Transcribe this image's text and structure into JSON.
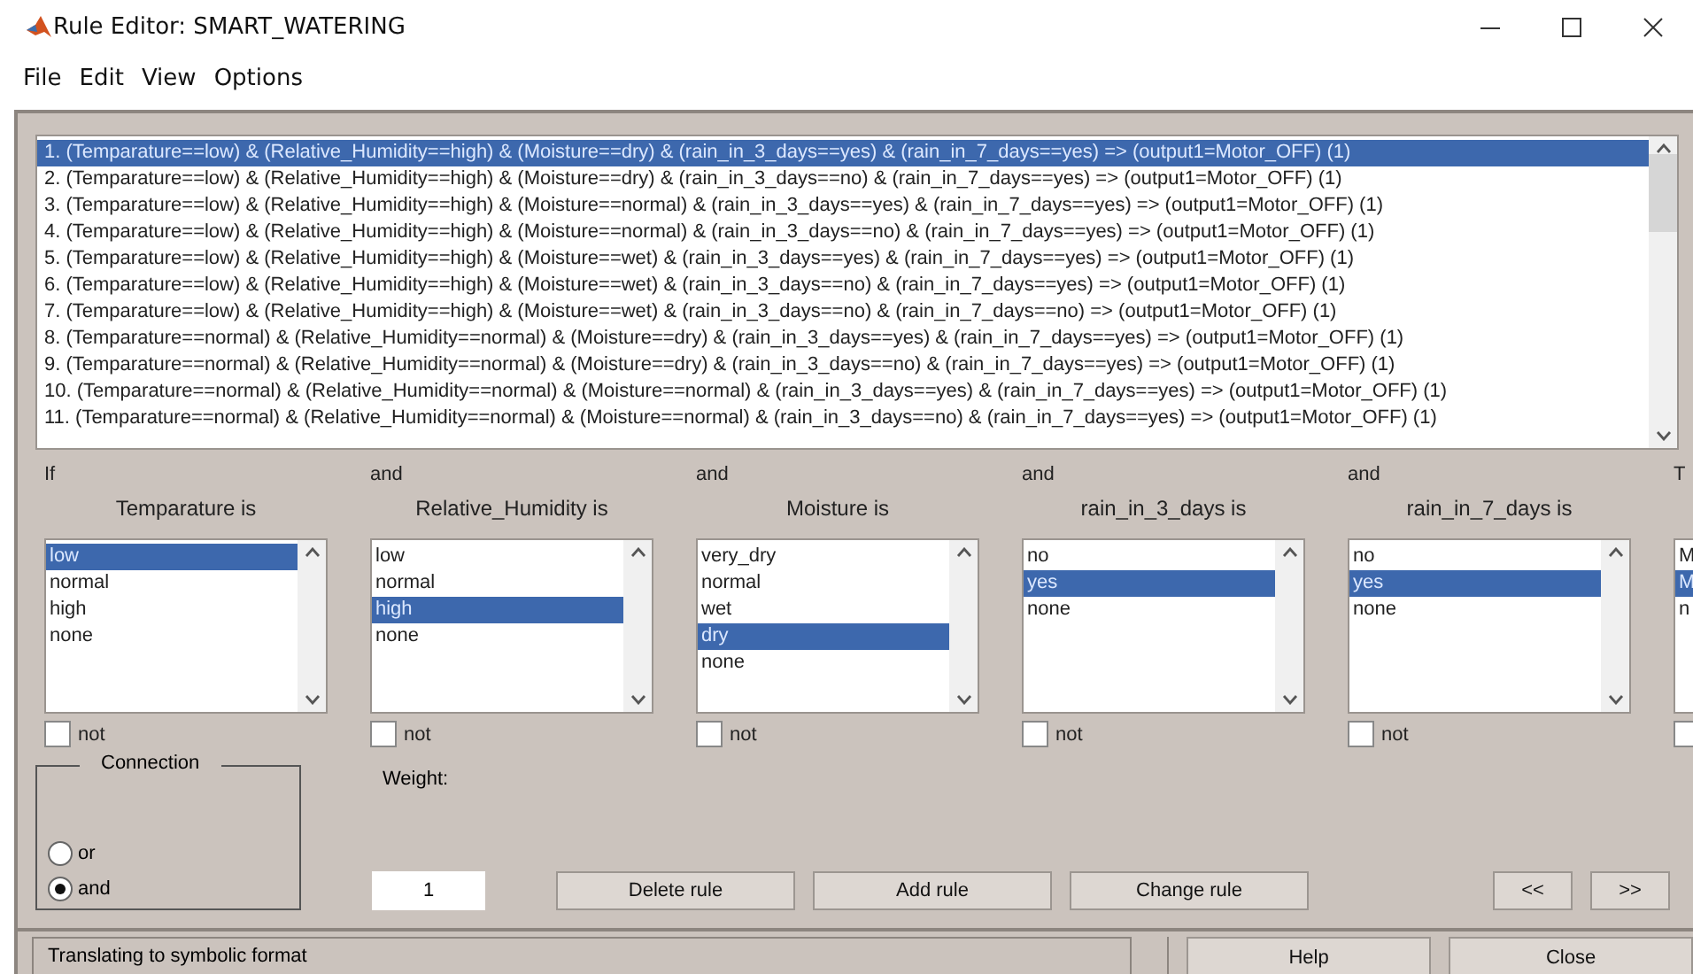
{
  "window": {
    "title": "Rule Editor: SMART_WATERING"
  },
  "menu": [
    "File",
    "Edit",
    "View",
    "Options"
  ],
  "rules": [
    {
      "text": "1. (Temparature==low) & (Relative_Humidity==high) & (Moisture==dry) & (rain_in_3_days==yes) & (rain_in_7_days==yes) => (output1=Motor_OFF) (1)",
      "selected": true
    },
    {
      "text": "2. (Temparature==low) & (Relative_Humidity==high) & (Moisture==dry) & (rain_in_3_days==no) & (rain_in_7_days==yes) => (output1=Motor_OFF) (1)",
      "selected": false
    },
    {
      "text": "3. (Temparature==low) & (Relative_Humidity==high) & (Moisture==normal) & (rain_in_3_days==yes) & (rain_in_7_days==yes) => (output1=Motor_OFF) (1)",
      "selected": false
    },
    {
      "text": "4. (Temparature==low) & (Relative_Humidity==high) & (Moisture==normal) & (rain_in_3_days==no) & (rain_in_7_days==yes) => (output1=Motor_OFF) (1)",
      "selected": false
    },
    {
      "text": "5. (Temparature==low) & (Relative_Humidity==high) & (Moisture==wet) & (rain_in_3_days==yes) & (rain_in_7_days==yes) => (output1=Motor_OFF) (1)",
      "selected": false
    },
    {
      "text": "6. (Temparature==low) & (Relative_Humidity==high) & (Moisture==wet) & (rain_in_3_days==no) & (rain_in_7_days==yes) => (output1=Motor_OFF) (1)",
      "selected": false
    },
    {
      "text": "7. (Temparature==low) & (Relative_Humidity==high) & (Moisture==wet) & (rain_in_3_days==no) & (rain_in_7_days==no) => (output1=Motor_OFF) (1)",
      "selected": false
    },
    {
      "text": "8. (Temparature==normal) & (Relative_Humidity==normal) & (Moisture==dry) & (rain_in_3_days==yes) & (rain_in_7_days==yes) => (output1=Motor_OFF) (1)",
      "selected": false
    },
    {
      "text": "9. (Temparature==normal) & (Relative_Humidity==normal) & (Moisture==dry) & (rain_in_3_days==no) & (rain_in_7_days==yes) => (output1=Motor_OFF) (1)",
      "selected": false
    },
    {
      "text": "10. (Temparature==normal) & (Relative_Humidity==normal) & (Moisture==normal) & (rain_in_3_days==yes) & (rain_in_7_days==yes) => (output1=Motor_OFF) (1)",
      "selected": false
    },
    {
      "text": "11. (Temparature==normal) & (Relative_Humidity==normal) & (Moisture==normal) & (rain_in_3_days==no) & (rain_in_7_days==yes) => (output1=Motor_OFF) (1)",
      "selected": false
    }
  ],
  "variables": [
    {
      "connector": "If",
      "title": "Temparature is",
      "not": false,
      "not_label": "not",
      "options": [
        {
          "label": "low",
          "selected": true
        },
        {
          "label": "normal",
          "selected": false
        },
        {
          "label": "high",
          "selected": false
        },
        {
          "label": "none",
          "selected": false
        }
      ]
    },
    {
      "connector": "and",
      "title": "Relative_Humidity is",
      "not": false,
      "not_label": "not",
      "options": [
        {
          "label": "low",
          "selected": false
        },
        {
          "label": "normal",
          "selected": false
        },
        {
          "label": "high",
          "selected": true
        },
        {
          "label": "none",
          "selected": false
        }
      ]
    },
    {
      "connector": "and",
      "title": "Moisture is",
      "not": false,
      "not_label": "not",
      "options": [
        {
          "label": "very_dry",
          "selected": false
        },
        {
          "label": "normal",
          "selected": false
        },
        {
          "label": "wet",
          "selected": false
        },
        {
          "label": "dry",
          "selected": true
        },
        {
          "label": "none",
          "selected": false
        }
      ]
    },
    {
      "connector": "and",
      "title": "rain_in_3_days is",
      "not": false,
      "not_label": "not",
      "options": [
        {
          "label": "no",
          "selected": false
        },
        {
          "label": "yes",
          "selected": true
        },
        {
          "label": "none",
          "selected": false
        }
      ]
    },
    {
      "connector": "and",
      "title": "rain_in_7_days is",
      "not": false,
      "not_label": "not",
      "options": [
        {
          "label": "no",
          "selected": false
        },
        {
          "label": "yes",
          "selected": true
        },
        {
          "label": "none",
          "selected": false
        }
      ]
    },
    {
      "connector": "T",
      "not": false,
      "options": [
        {
          "label": "M",
          "selected": false
        },
        {
          "label": "M",
          "selected": true
        },
        {
          "label": "n",
          "selected": false
        }
      ]
    }
  ],
  "connection": {
    "title": "Connection",
    "options": [
      {
        "label": "or",
        "selected": false
      },
      {
        "label": "and",
        "selected": true
      }
    ]
  },
  "weight": {
    "label": "Weight:",
    "value": "1"
  },
  "actions": [
    "Delete rule",
    "Add rule",
    "Change rule"
  ],
  "nav": [
    "<<",
    ">>"
  ],
  "status": "Translating to symbolic format",
  "footer_buttons": [
    "Help",
    "Close"
  ]
}
